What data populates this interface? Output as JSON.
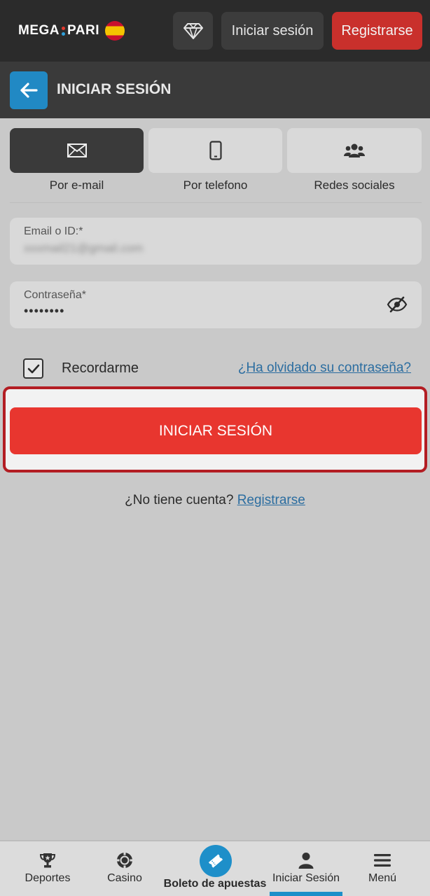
{
  "header": {
    "logo_left": "MEGA",
    "logo_right": "PARI",
    "login_label": "Iniciar sesión",
    "register_label": "Registrarse"
  },
  "titlebar": {
    "title": "INICIAR SESIÓN"
  },
  "tabs": [
    {
      "label": "Por e-mail",
      "icon": "envelope-icon",
      "active": true
    },
    {
      "label": "Por telefono",
      "icon": "phone-icon",
      "active": false
    },
    {
      "label": "Redes sociales",
      "icon": "users-icon",
      "active": false
    }
  ],
  "form": {
    "email_label": "Email o ID:*",
    "email_value": "xxxmail21@gmail.com",
    "password_label": "Contraseña*",
    "password_value": "••••••••",
    "remember_label": "Recordarme",
    "remember_checked": true,
    "forgot_label": "¿Ha olvidado su contraseña?",
    "submit_label": "INICIAR SESIÓN",
    "no_account_text": "¿No tiene cuenta? ",
    "register_link": "Registrarse"
  },
  "bottom_nav": [
    {
      "label": "Deportes",
      "icon": "trophy-icon"
    },
    {
      "label": "Casino",
      "icon": "chip-icon"
    },
    {
      "label": "Boleto de apuestas",
      "icon": "ticket-icon"
    },
    {
      "label": "Iniciar Sesión",
      "icon": "user-icon",
      "active": true
    },
    {
      "label": "Menú",
      "icon": "hamburger-icon"
    }
  ],
  "colors": {
    "accent_red": "#e8362f",
    "accent_blue": "#1e8fc9",
    "header_bg": "#2b2b2b"
  }
}
